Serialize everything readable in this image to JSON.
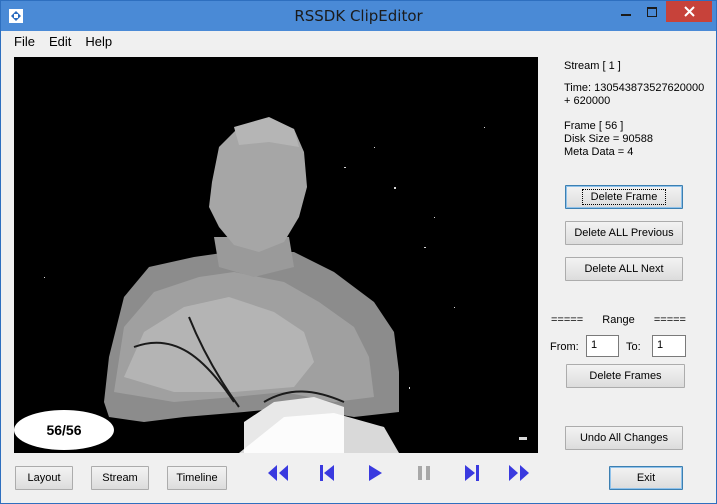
{
  "window": {
    "title": "RSSDK ClipEditor"
  },
  "menu": {
    "file": "File",
    "edit": "Edit",
    "help": "Help"
  },
  "viewer": {
    "frame_counter": "56/56"
  },
  "info": {
    "stream": "Stream  [ 1 ]",
    "time_line1": "Time: 130543873527620000",
    "time_line2": "+ 620000",
    "frame": "Frame [ 56 ]",
    "disk_size": "Disk Size =  90588",
    "meta_data": "Meta Data =  4"
  },
  "buttons": {
    "delete_frame": "Delete Frame",
    "delete_all_previous": "Delete ALL Previous",
    "delete_all_next": "Delete ALL Next",
    "delete_frames": "Delete Frames",
    "undo_all_changes": "Undo All Changes",
    "exit": "Exit",
    "layout": "Layout",
    "stream": "Stream",
    "timeline": "Timeline"
  },
  "range": {
    "dashes_left": "=====",
    "label": "Range",
    "dashes_right": "=====",
    "from_label": "From:",
    "from_value": "1",
    "to_label": "To:",
    "to_value": "1"
  },
  "nav_icons": [
    "first-frame-icon",
    "previous-frame-icon",
    "play-icon",
    "pause-icon",
    "next-frame-icon",
    "last-frame-icon"
  ],
  "colors": {
    "title_bar": "#4a8ad6",
    "close_button": "#c7423a",
    "nav_icon": "#3a3adf",
    "nav_icon_disabled": "#a8a8a8",
    "viewer_background": "#000000"
  }
}
